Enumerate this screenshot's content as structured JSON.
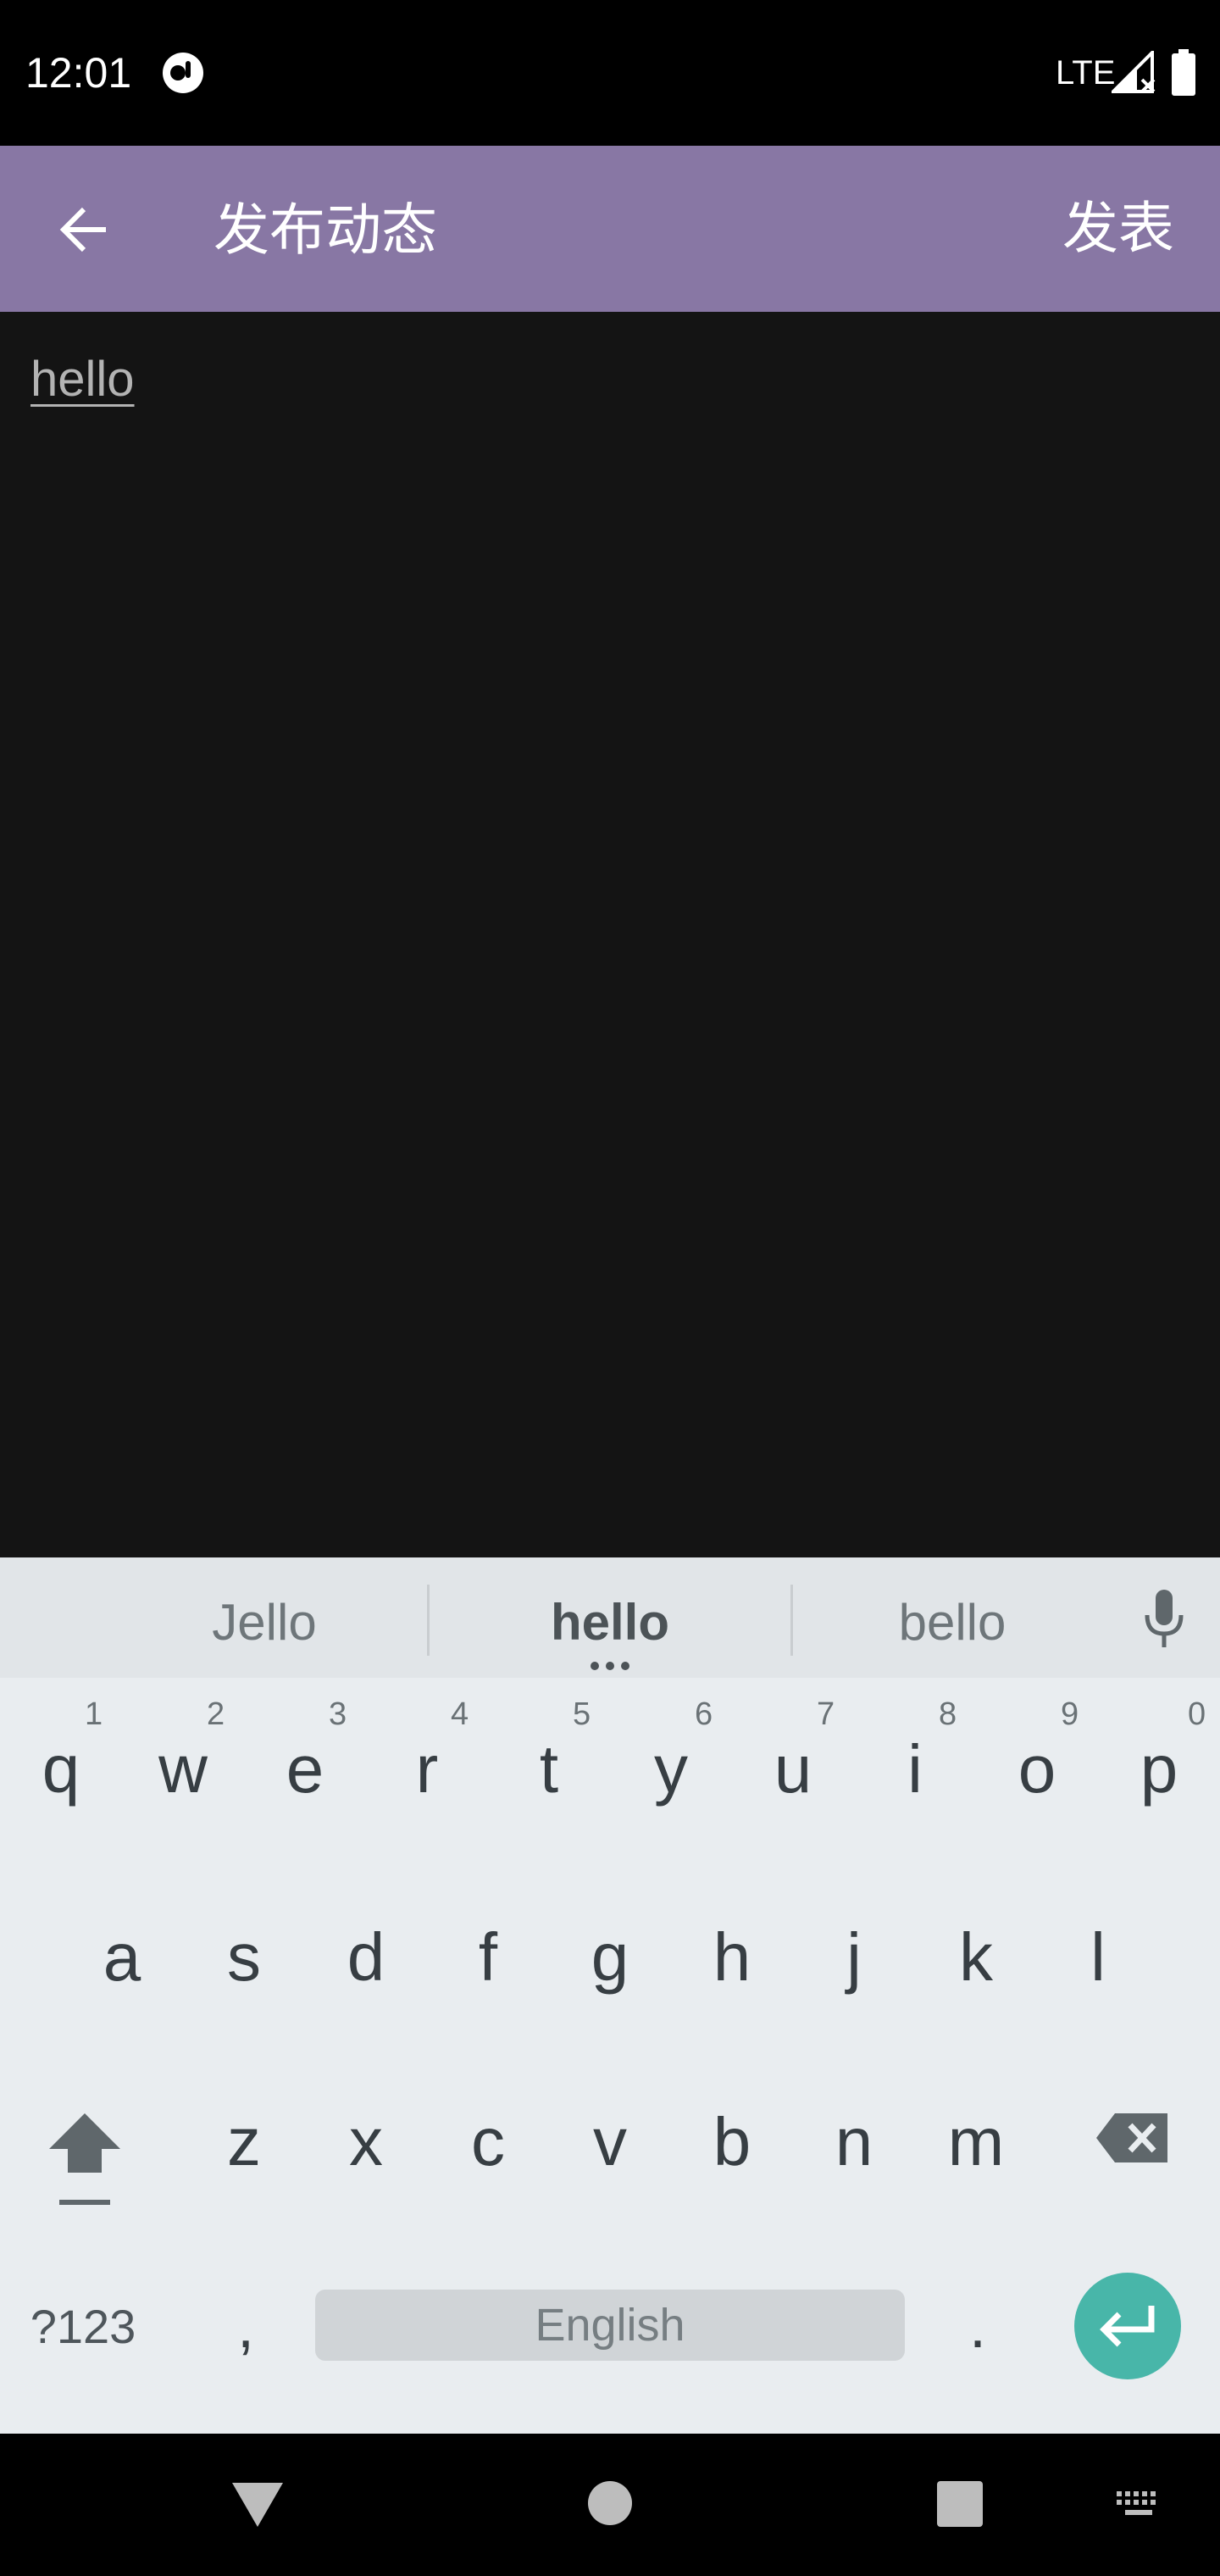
{
  "status_bar": {
    "time": "12:01",
    "network": "LTE",
    "icons": [
      "app-notification-icon",
      "signal-icon",
      "battery-icon"
    ]
  },
  "app_bar": {
    "title": "发布动态",
    "action_label": "发表",
    "background_color": "#8877a4",
    "back_icon": "arrow-left-icon"
  },
  "editor": {
    "value": "hello"
  },
  "keyboard": {
    "suggestions": [
      "Jello",
      "hello",
      "bello"
    ],
    "row1": [
      {
        "key": "q",
        "hint": "1"
      },
      {
        "key": "w",
        "hint": "2"
      },
      {
        "key": "e",
        "hint": "3"
      },
      {
        "key": "r",
        "hint": "4"
      },
      {
        "key": "t",
        "hint": "5"
      },
      {
        "key": "y",
        "hint": "6"
      },
      {
        "key": "u",
        "hint": "7"
      },
      {
        "key": "i",
        "hint": "8"
      },
      {
        "key": "o",
        "hint": "9"
      },
      {
        "key": "p",
        "hint": "0"
      }
    ],
    "row2": [
      "a",
      "s",
      "d",
      "f",
      "g",
      "h",
      "j",
      "k",
      "l"
    ],
    "row3": [
      "z",
      "x",
      "c",
      "v",
      "b",
      "n",
      "m"
    ],
    "symbols_label": "?123",
    "comma": ",",
    "space_label": "English",
    "period": ".",
    "enter_color": "#48b6a9"
  },
  "nav_bar": {
    "icons": [
      "nav-back-icon",
      "nav-home-icon",
      "nav-recents-icon",
      "keyboard-switch-icon"
    ]
  }
}
